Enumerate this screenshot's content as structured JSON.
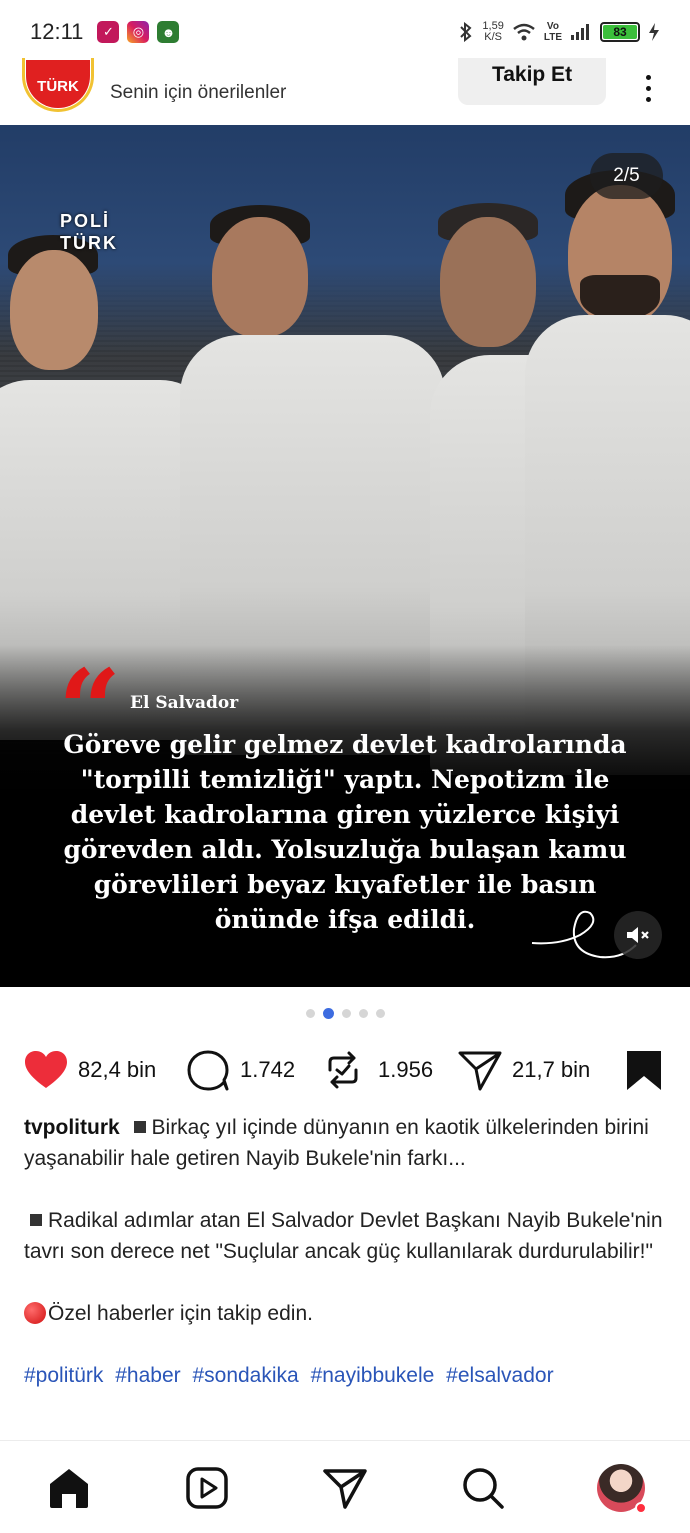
{
  "status_bar": {
    "time": "12:11",
    "net_speed_value": "1,59",
    "net_speed_unit": "K/S",
    "volte_top": "Vo",
    "volte_bottom": "LTE",
    "battery": "83"
  },
  "header": {
    "logo_text": "TÜRK",
    "subtitle": "Senin için önerilenler",
    "follow_label": "Takip Et"
  },
  "media": {
    "counter": "2/5",
    "logo_line1": "POLİ",
    "logo_line2": "TÜRK",
    "location": "El Salvador",
    "overlay_text": "Göreve gelir gelmez devlet kadrolarında \"torpilli temizliği\" yaptı. Nepotizm ile devlet kadrolarına giren yüzlerce kişiyi görevden aldı. Yolsuzluğa bulaşan kamu görevlileri beyaz kıyafetler ile basın önünde ifşa edildi."
  },
  "carousel": {
    "count": 5,
    "active_index": 1
  },
  "actions": {
    "likes": "82,4 bin",
    "comments": "1.742",
    "reposts": "1.956",
    "shares": "21,7 bin"
  },
  "caption": {
    "username": "tvpoliturk",
    "line1": "Birkaç yıl içinde dünyanın en kaotik ülkelerinden birini yaşanabilir hale getiren Nayib Bukele'nin farkı...",
    "line2": "Radikal adımlar atan El Salvador Devlet Başkanı Nayib Bukele'nin tavrı son derece net \"Suçlular ancak güç kullanılarak durdurulabilir!\"",
    "line3": "Özel haberler için takip edin.",
    "hashtags": [
      "#politürk",
      "#haber",
      "#sondakika",
      "#nayibbukele",
      "#elsalvador"
    ]
  },
  "colors": {
    "like_red": "#ed2d3a",
    "hashtag_blue": "#2a55b8",
    "accent_dot": "#3d6ce0"
  }
}
